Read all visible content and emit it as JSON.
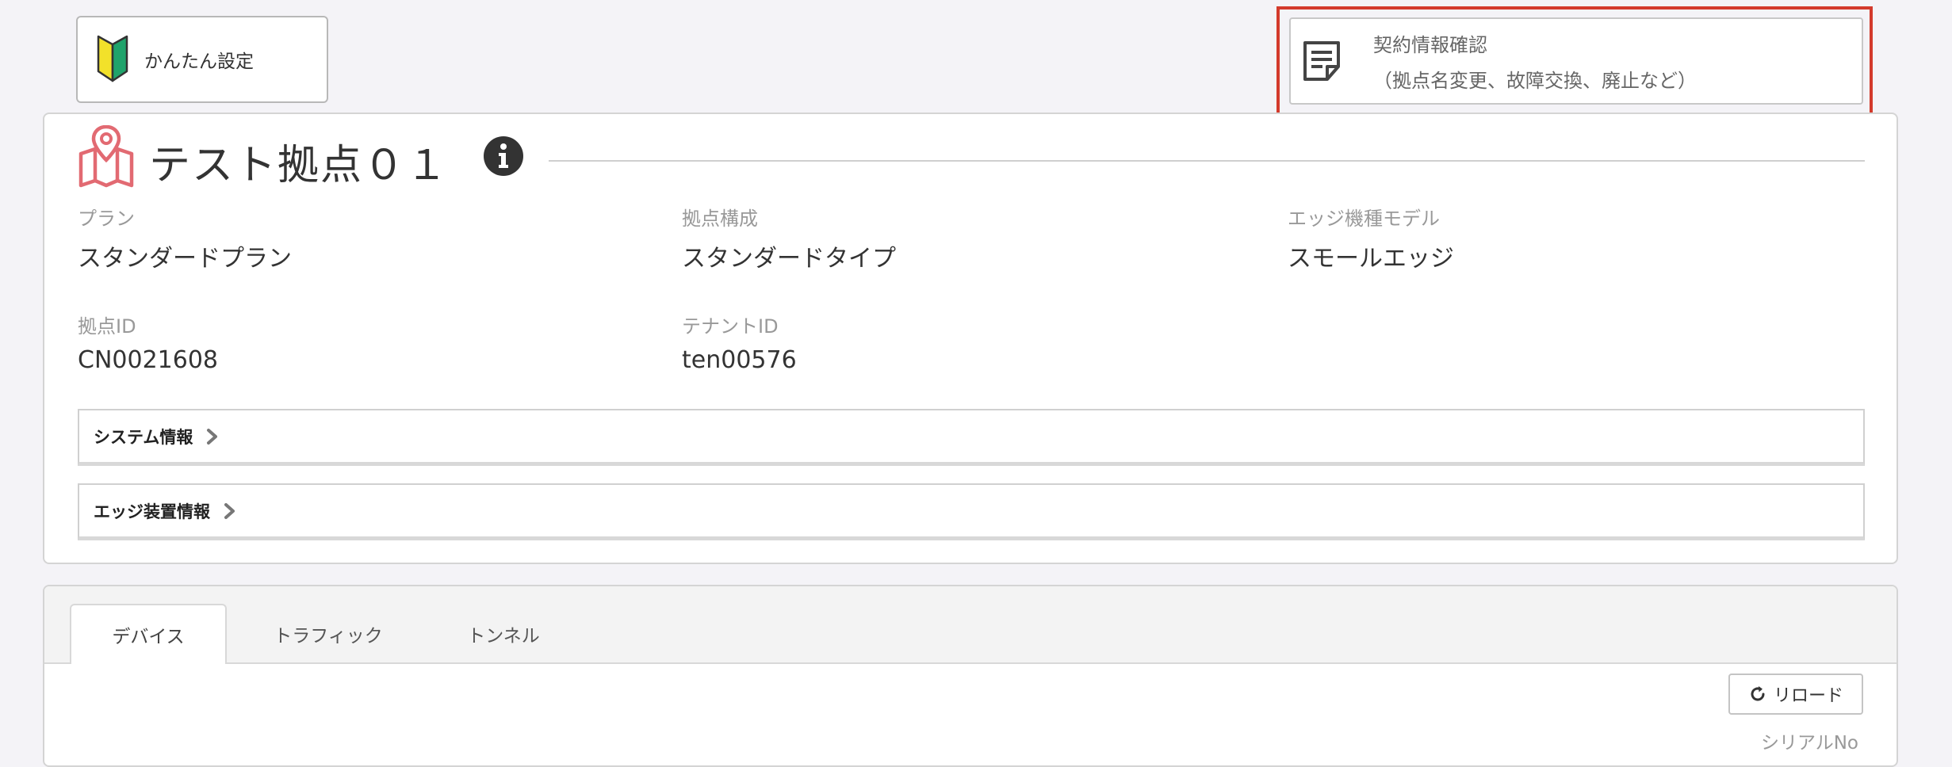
{
  "top": {
    "easy_setup_label": "かんたん設定",
    "contract": {
      "line1": "契約情報確認",
      "line2": "（拠点名変更、故障交換、廃止など）"
    }
  },
  "site": {
    "title": "テスト拠点０１",
    "fields": {
      "plan_label": "プラン",
      "plan_value": "スタンダードプラン",
      "config_label": "拠点構成",
      "config_value": "スタンダードタイプ",
      "edge_model_label": "エッジ機種モデル",
      "edge_model_value": "スモールエッジ",
      "site_id_label": "拠点ID",
      "site_id_value": "CN0021608",
      "tenant_id_label": "テナントID",
      "tenant_id_value": "ten00576"
    },
    "accordions": {
      "system_info": "システム情報",
      "edge_device_info": "エッジ装置情報"
    }
  },
  "tabs": {
    "items": [
      {
        "label": "デバイス",
        "active": true
      },
      {
        "label": "トラフィック",
        "active": false
      },
      {
        "label": "トンネル",
        "active": false
      }
    ],
    "reload_label": "リロード",
    "column_serial": "シリアルNo"
  },
  "colors": {
    "highlight": "#d33a2c",
    "map_icon": "#e26a72",
    "beginner_yellow": "#f2e12a",
    "beginner_green": "#1fa36b"
  }
}
